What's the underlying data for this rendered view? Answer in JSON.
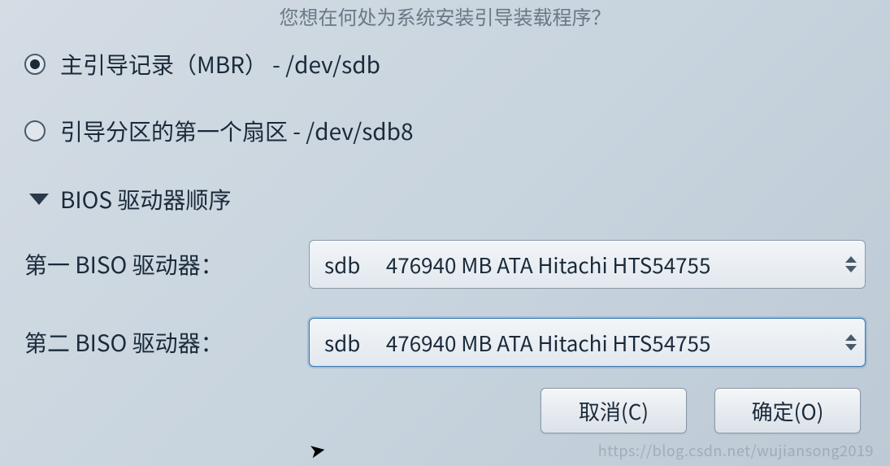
{
  "header": {
    "question": "您想在何处为系统安装引导装载程序？"
  },
  "radios": {
    "mbr": {
      "label": "主引导记录（MBR） - /dev/sdb",
      "selected": true
    },
    "first_sector": {
      "label": "引导分区的第一个扇区 - /dev/sdb8",
      "selected": false
    }
  },
  "expander": {
    "label": "BIOS 驱动器顺序"
  },
  "drives": {
    "first": {
      "label": "第一 BISO 驱动器：",
      "device": "sdb",
      "desc": "476940 MB ATA Hitachi HTS54755"
    },
    "second": {
      "label": "第二 BISO 驱动器：",
      "device": "sdb",
      "desc": "476940 MB ATA Hitachi HTS54755"
    }
  },
  "buttons": {
    "cancel": "取消(C)",
    "ok": "确定(O)"
  },
  "watermark": "https://blog.csdn.net/wujiansong2019"
}
